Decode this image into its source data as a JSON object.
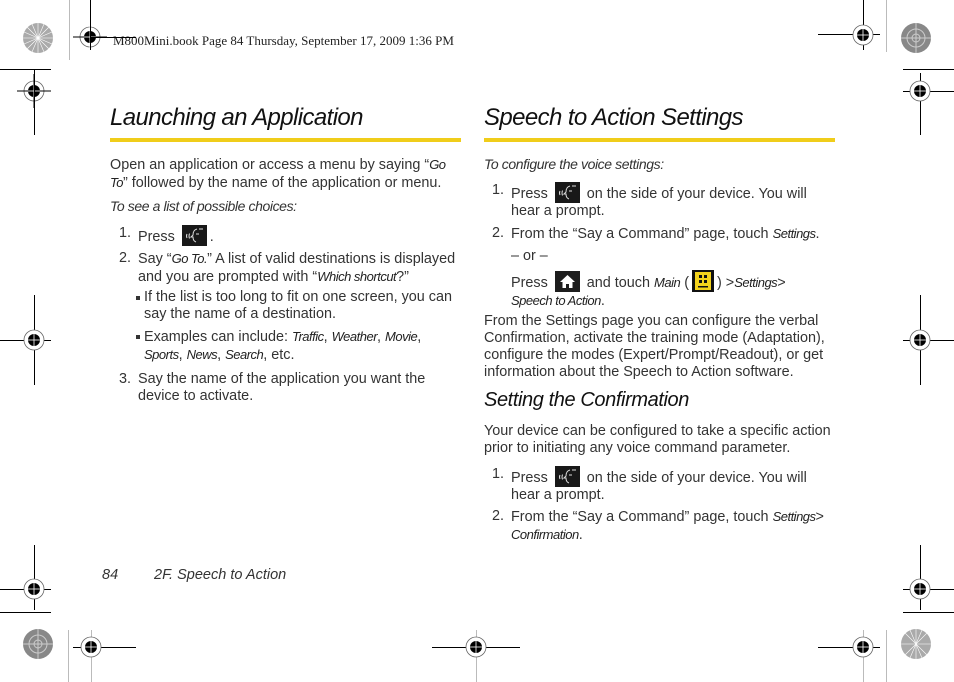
{
  "print_header": "M800Mini.book  Page 84  Thursday, September 17, 2009  1:36 PM",
  "left": {
    "title": "Launching an Application",
    "intro_prefix": "Open an application or access a menu by saying “",
    "intro_em1": "Go",
    "intro_em2": "To",
    "intro_suffix": "” followed by the name of the application or menu.",
    "lead": "To see a list of possible choices:",
    "steps": [
      {
        "num": "1.",
        "prefix": "Press",
        "suffix": "."
      },
      {
        "num": "2.",
        "p1": "Say “",
        "em1": "Go To.",
        "p2": "” A list of valid destinations is displayed and you are prompted with “",
        "em2": "Which shortcut",
        "p3": "?”"
      },
      {
        "num": "3.",
        "text": "Say the name of the application you want the device to activate."
      }
    ],
    "bullets": [
      {
        "text": "If the list is too long to fit on one screen, you can say the name of a destination."
      },
      {
        "prefix": "Examples can include: ",
        "items": [
          "Traffic",
          "Weather",
          "Movie",
          "Sports",
          "News",
          "Search"
        ],
        "suffix": "etc."
      }
    ]
  },
  "right": {
    "title": "Speech to Action Settings",
    "lead": "To configure the voice settings:",
    "steps": [
      {
        "num": "1.",
        "prefix": "Press",
        "suffix": "on the side of your device. You will hear a prompt."
      },
      {
        "num": "2.",
        "text": "From the “Say a Command” page, touch ",
        "em": "Settings",
        "end": "."
      }
    ],
    "or": "– or –",
    "alt": {
      "prefix": "Press",
      "mid": "and touch",
      "main": "Main",
      "open": "(",
      "close": ")",
      "sep": ">",
      "settings": "Settings",
      "target": "Speech to Action",
      "end": "."
    },
    "body": "From the Settings page you can configure the verbal Confirmation, activate the training mode (Adaptation), configure the modes (Expert/Prompt/Readout), or get information about the Speech to Action software.",
    "subtitle": "Setting the Confirmation",
    "sub_body": "Your device can be configured to take a specific action prior to initiating any voice command parameter.",
    "sub_steps": [
      {
        "num": "1.",
        "prefix": "Press",
        "suffix": "on the side of your device. You will hear a prompt."
      },
      {
        "num": "2.",
        "text": "From the “Say a Command” page, touch ",
        "em": "Settings",
        "sep": ">",
        "em2": "Confirmation",
        "end": "."
      }
    ]
  },
  "icons": {
    "voice": "voice-command-key-icon",
    "home": "home-key-icon",
    "main": "main-menu-icon",
    "main_label": "Main"
  },
  "footer": {
    "page": "84",
    "section": "2F. Speech to Action"
  },
  "colors": {
    "accent_rule": "#f0cd1a",
    "main_icon": "#f3d21c"
  }
}
